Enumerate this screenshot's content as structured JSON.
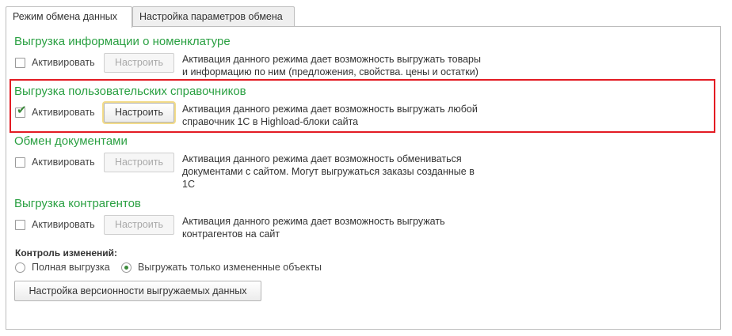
{
  "tabs": [
    {
      "label": "Режим обмена данных",
      "active": true
    },
    {
      "label": "Настройка параметров обмена",
      "active": false
    }
  ],
  "sections": [
    {
      "title": "Выгрузка информации о номенклатуре",
      "checkbox_label": "Активировать",
      "checked": false,
      "button_label": "Настроить",
      "button_enabled": false,
      "description": [
        "Активация данного режима дает возможность выгружать товары",
        "и информацию по ним (предложения, свойства. цены и остатки)"
      ]
    },
    {
      "title": "Выгрузка пользовательских справочников",
      "checkbox_label": "Активировать",
      "checked": true,
      "button_label": "Настроить",
      "button_enabled": true,
      "description": [
        "Активация данного режима дает возможность выгружать любой",
        "справочник 1С в Highload-блоки сайта"
      ]
    },
    {
      "title": "Обмен документами",
      "checkbox_label": "Активировать",
      "checked": false,
      "button_label": "Настроить",
      "button_enabled": false,
      "description": [
        "Активация данного режима дает возможность обмениваться",
        "документами с сайтом. Могут выгружаться заказы созданные в",
        "1С"
      ]
    },
    {
      "title": "Выгрузка контрагентов",
      "checkbox_label": "Активировать",
      "checked": false,
      "button_label": "Настроить",
      "button_enabled": false,
      "description": [
        "Активация данного режима дает возможность выгружать",
        "контрагентов на сайт"
      ]
    }
  ],
  "change_control": {
    "label": "Контроль изменений:",
    "options": [
      {
        "label": "Полная выгрузка",
        "selected": false
      },
      {
        "label": "Выгружать только измененные объекты",
        "selected": true
      }
    ]
  },
  "versioning_button": "Настройка версионности выгружаемых данных",
  "colors": {
    "section_title": "#2aa042",
    "highlight_border": "#e31b23",
    "check": "#3a8a3a"
  }
}
